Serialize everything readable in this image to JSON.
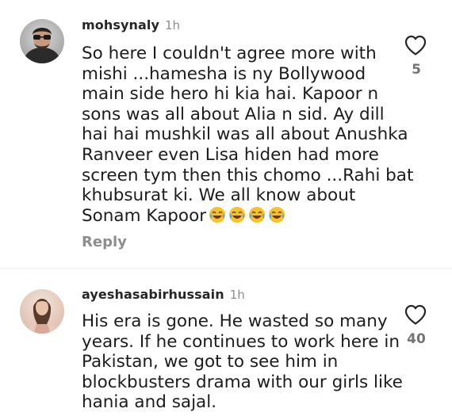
{
  "comments": [
    {
      "username": "mohsynaly",
      "time": "1h",
      "lines": [
        "So here I couldn't agree more with",
        "mishi ...hamesha is ny Bollywood",
        "main side hero hi kia hai. Kapoor n",
        "sons was all about Alia n sid.  Ay dill",
        "hai hai mushkil was all about Anushka",
        "Ranveer even Lisa hiden had more",
        "screen tym then this chomo ...Rahi bat",
        "khubsurat ki. We all know about",
        "Sonam Kapoor"
      ],
      "emoji": [
        "face-with-tears-of-joy",
        "face-with-tears-of-joy",
        "face-with-tears-of-joy",
        "face-with-tears-of-joy"
      ],
      "reply_label": "Reply",
      "likes": "5",
      "avatar_icon": "avatar-man-sunglasses"
    },
    {
      "username": "ayeshasabirhussain",
      "time": "1h",
      "lines": [
        "His era is gone. He wasted so many",
        "years. If he continues to work here in",
        "Pakistan, we got to see him in",
        "blockbusters drama with our girls like",
        "hania and sajal."
      ],
      "likes": "40",
      "avatar_icon": "avatar-woman-pink"
    }
  ],
  "colors": {
    "username": "#262626",
    "secondary": "#8e8e8e",
    "like_count": "#737373",
    "heart_stroke": "#262626"
  }
}
